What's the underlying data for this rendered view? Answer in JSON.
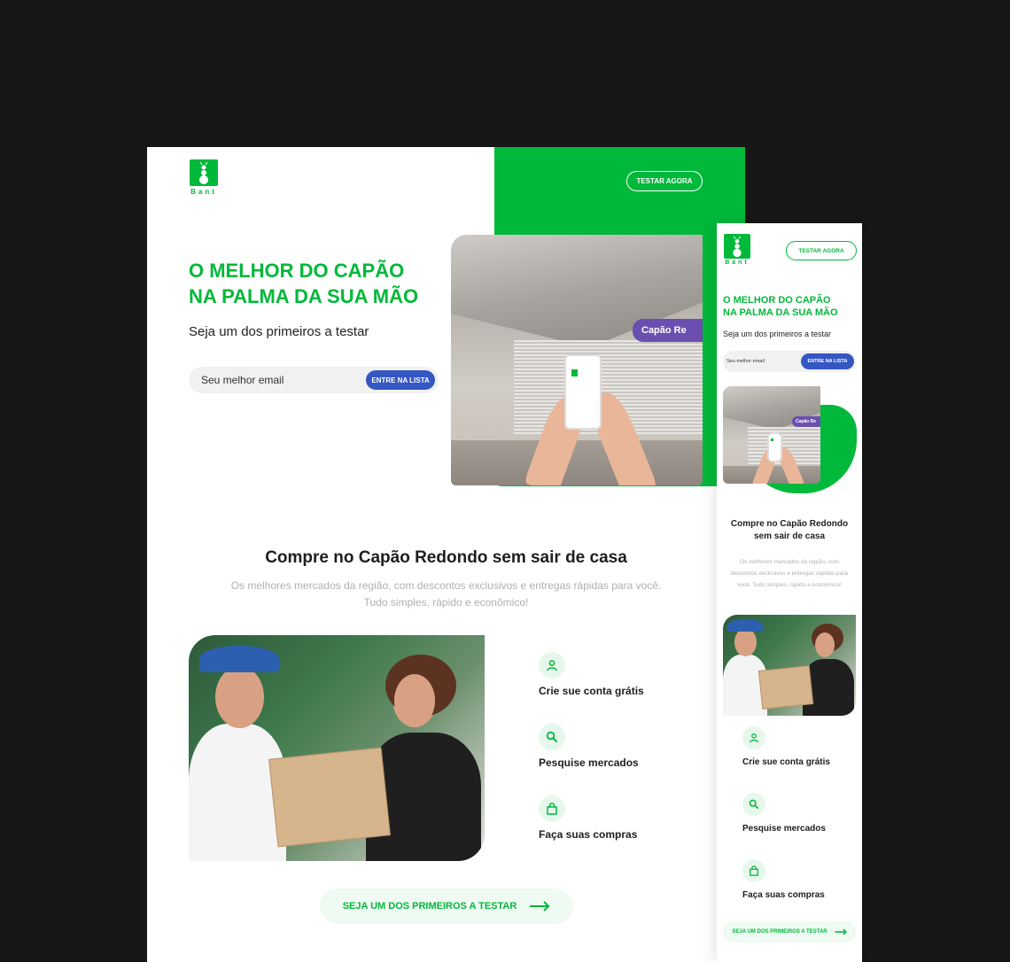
{
  "brand": {
    "name": "Bant",
    "color": "#00b83a",
    "accent_blue": "#3557c4",
    "icon": "ant-logo-icon"
  },
  "header": {
    "cta_label": "TESTAR AGORA"
  },
  "hero": {
    "title_line1": "O MELHOR DO CAPÃO",
    "title_line2": "NA PALMA DA SUA MÃO",
    "subtitle": "Seja um dos primeiros a testar",
    "email_placeholder": "Seu melhor email",
    "submit_label": "ENTRE NA LISTA",
    "station_sign": "Capão Re",
    "station_sign_mobile": "Capão Re"
  },
  "section": {
    "title": "Compre no Capão Redondo sem sair de casa",
    "title_mobile_line1": "Compre no Capão Redondo",
    "title_mobile_line2": "sem sair de casa",
    "desc_line1": "Os melhores mercados da região, com descontos exclusivos e entregas rápidas para você.",
    "desc_line2": "Tudo simples, rápido e econômico!",
    "desc_mobile_line1": "Os melhores mercados da região, com",
    "desc_mobile_line2": "descontos exclusivos e entregas rápidas para",
    "desc_mobile_line3": "você. Tudo simples, rápido e econômico!"
  },
  "features": [
    {
      "label": "Crie sue conta grátis",
      "icon": "user-icon"
    },
    {
      "label": "Pesquise mercados",
      "icon": "search-icon"
    },
    {
      "label": "Faça suas compras",
      "icon": "shopping-bag-icon"
    }
  ],
  "cta": {
    "label": "SEJA UM DOS PRIMEIROS A TESTAR",
    "icon": "arrow-right-icon"
  }
}
